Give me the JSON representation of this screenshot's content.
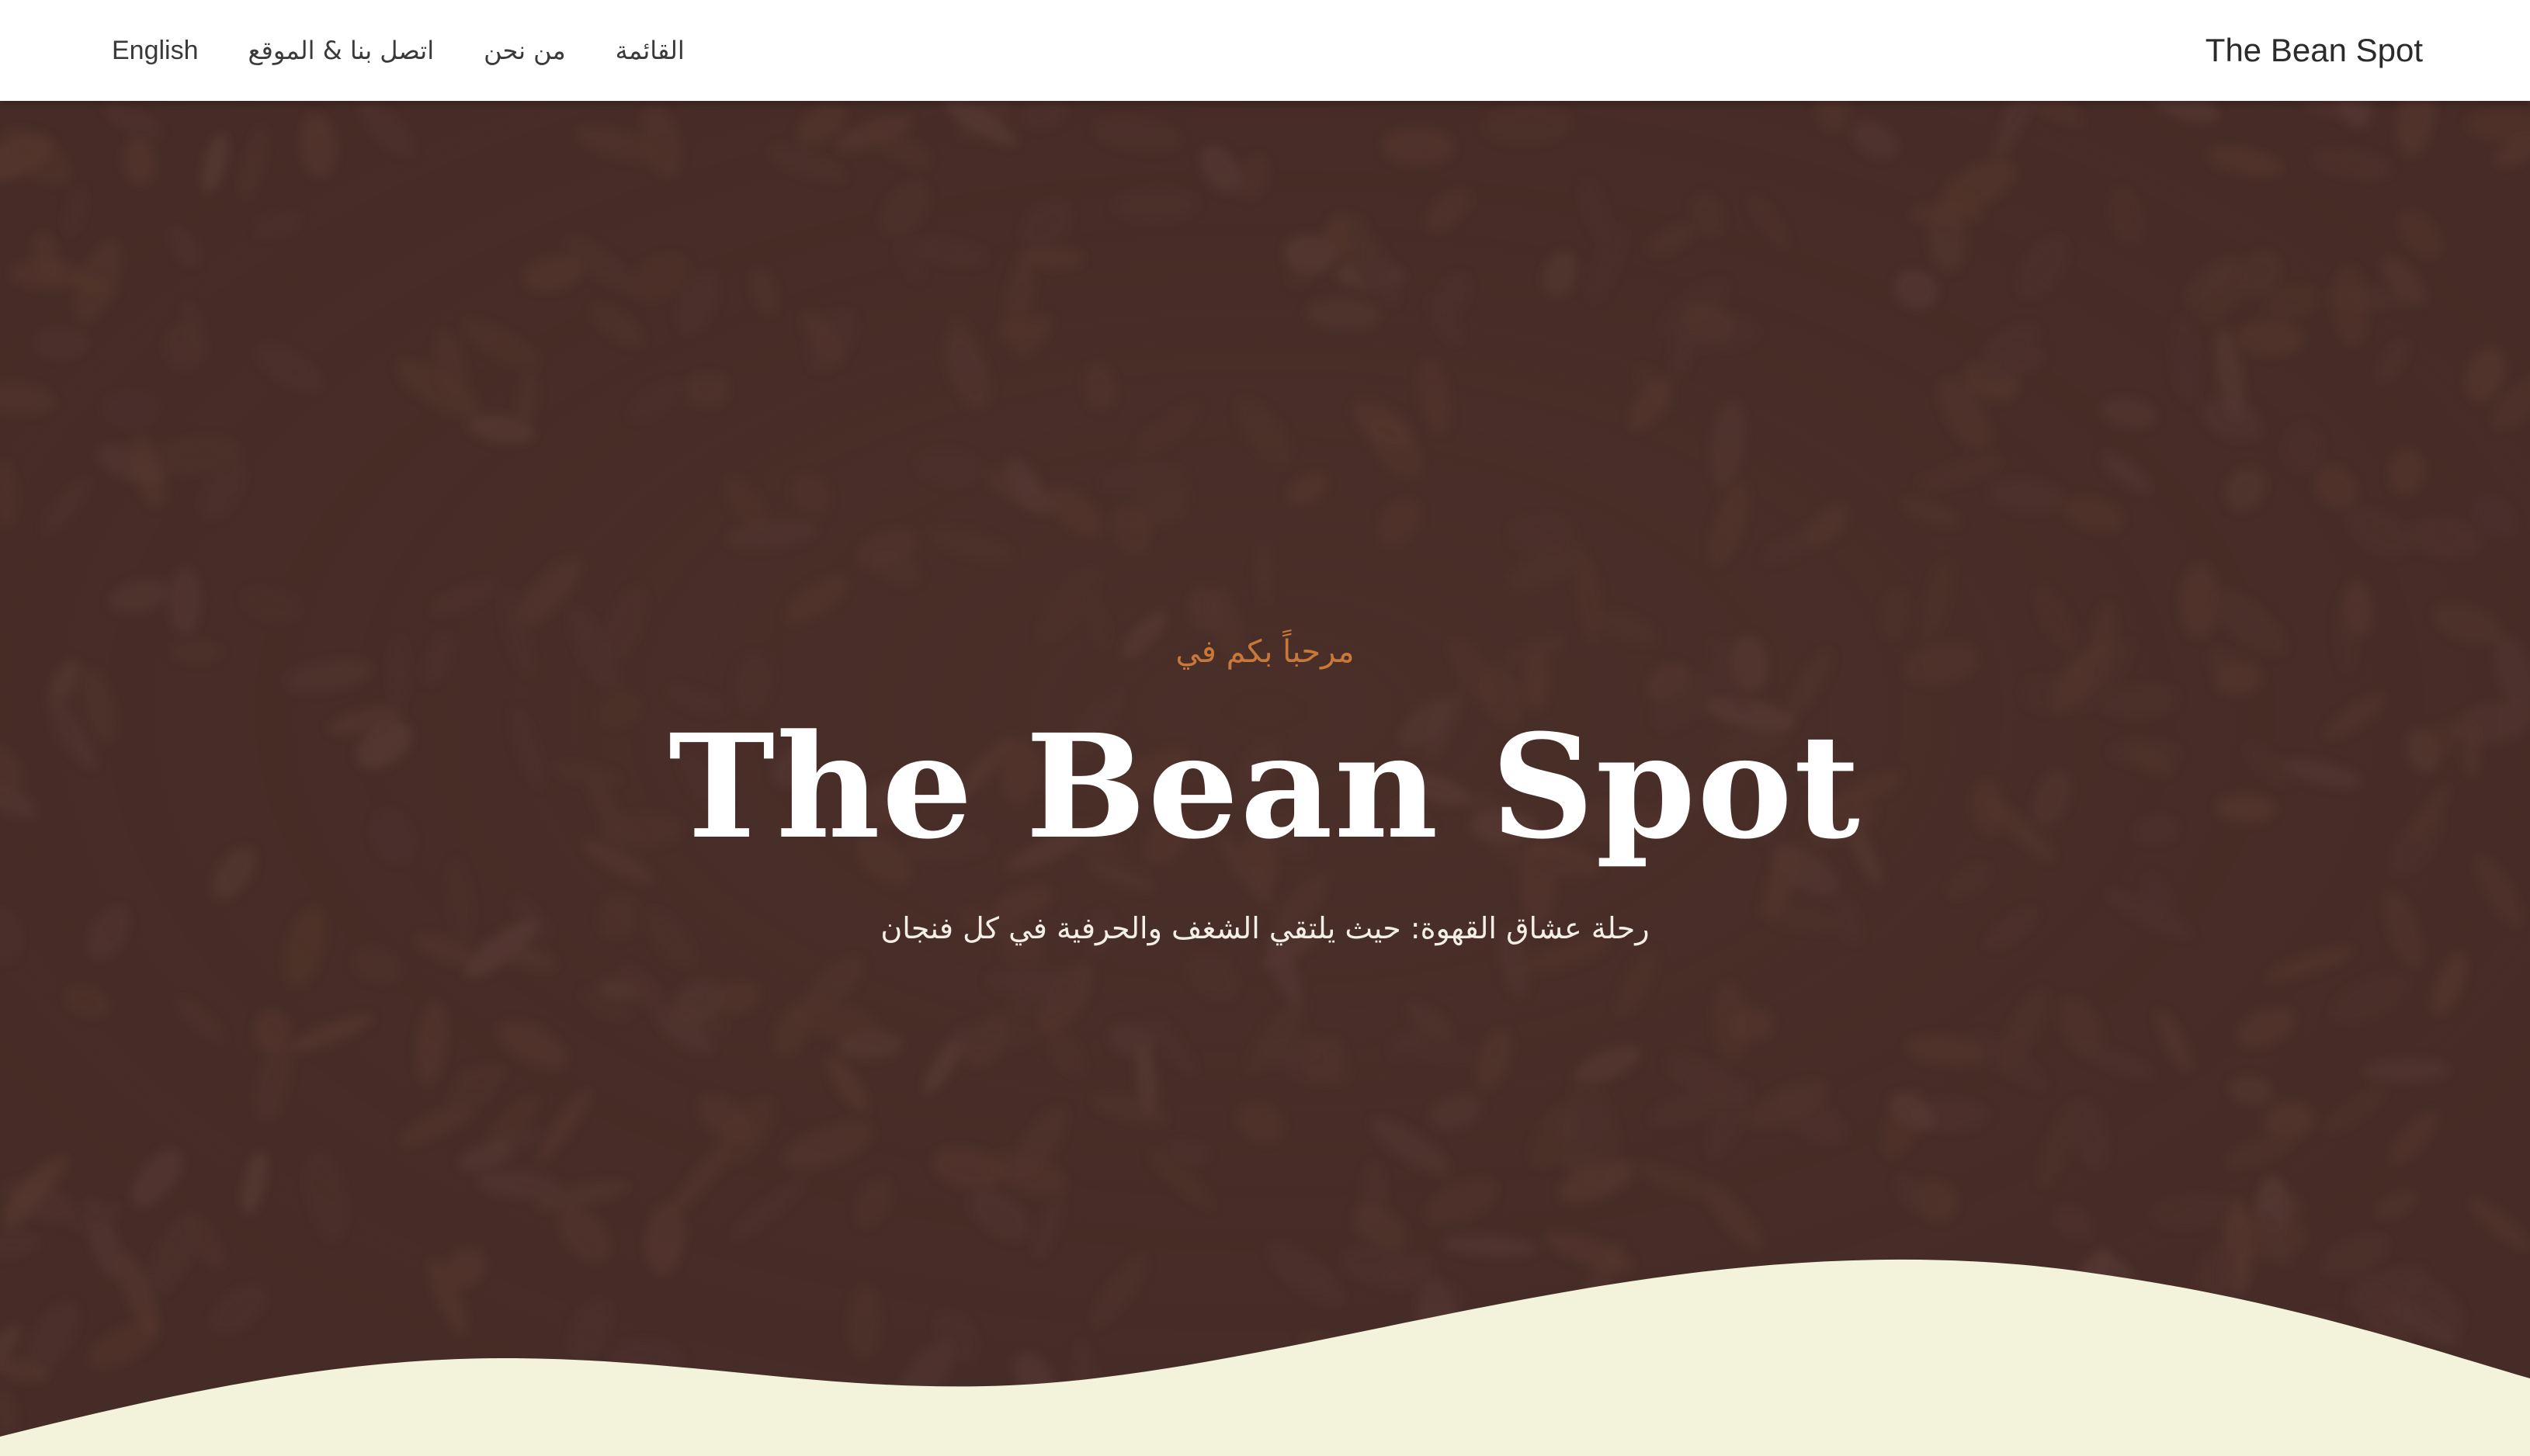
{
  "header": {
    "brand": "The Bean Spot",
    "nav": {
      "language_toggle": "English",
      "contact": "اتصل بنا & الموقع",
      "about": "من نحن",
      "menu": "القائمة"
    }
  },
  "hero": {
    "kicker": "مرحباً بكم في",
    "title": "The Bean Spot",
    "tagline": "رحلة عشاق القهوة: حيث يلتقي الشغف والحرفية في كل فنجان"
  },
  "colors": {
    "header_bg": "#ffffff",
    "hero_bg": "#4a2f29",
    "accent": "#c8793a",
    "wave_fill": "#f3f3dc",
    "bean_tone": "#5c3a30"
  },
  "icons": {
    "background": "coffee-beans-pattern"
  }
}
